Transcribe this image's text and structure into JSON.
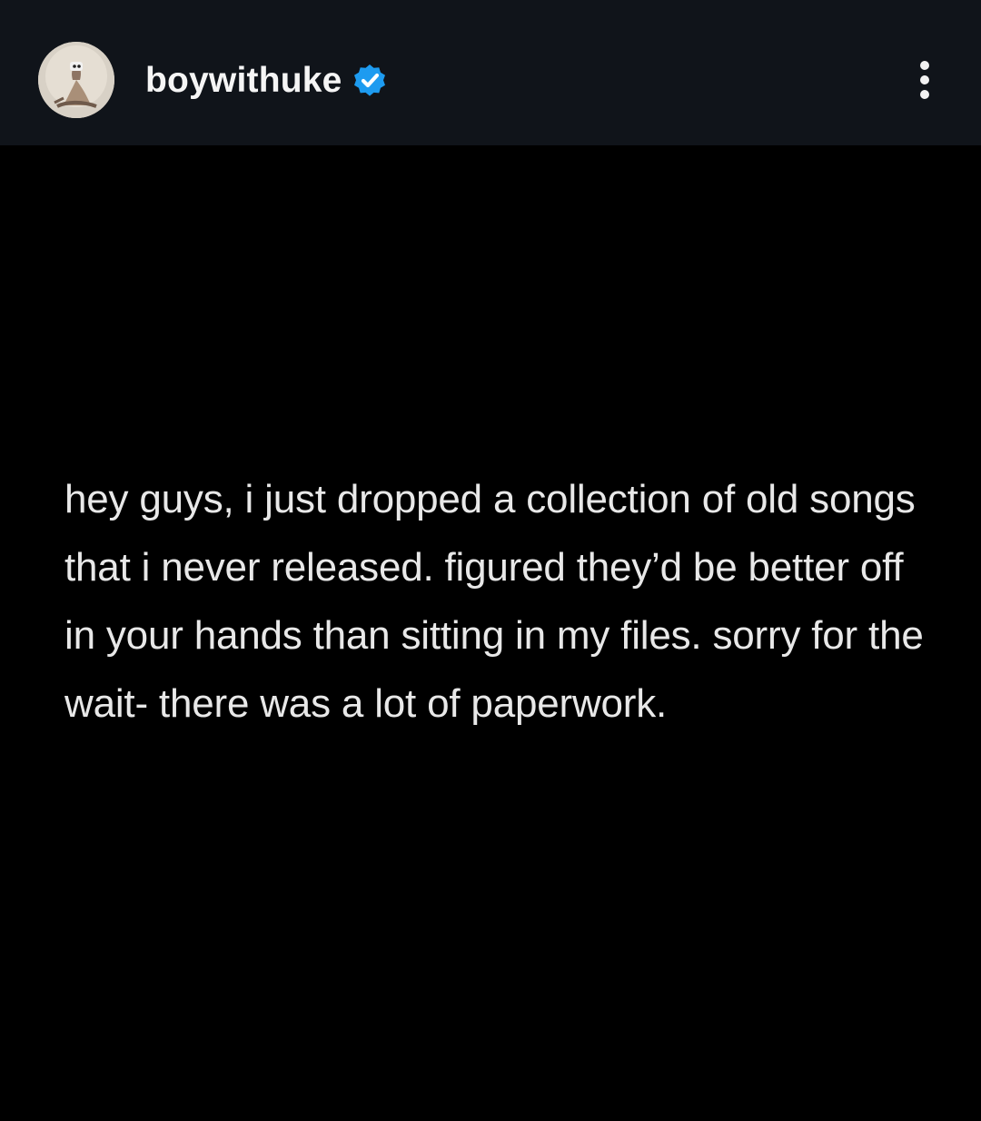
{
  "header": {
    "username": "boywithuke",
    "verified_badge": "verified-badge-icon",
    "avatar_icon": "profile-avatar",
    "more_icon": "more-vertical-icon"
  },
  "post": {
    "text": "hey guys, i just dropped a collection of old songs that i never released. figured they’d be better off in your hands than sitting in my files. sorry for the wait- there was a lot of paperwork."
  },
  "colors": {
    "header_background": "#10141a",
    "page_background": "#000000",
    "text": "#e8e8e8",
    "verified": "#1d9bf0"
  }
}
